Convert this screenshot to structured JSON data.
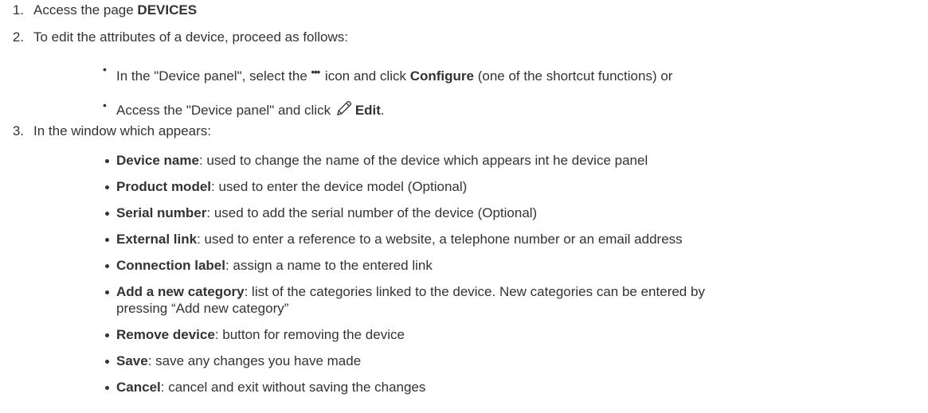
{
  "steps": [
    {
      "num": "1.",
      "prefix": "Access the page ",
      "bold": "DEVICES",
      "suffix": ""
    },
    {
      "num": "2.",
      "text": "To edit the attributes of a device, proceed as follows:"
    },
    {
      "num": "3.",
      "text": "In the window which appears:"
    }
  ],
  "step2_bullets": [
    {
      "bullet": "•",
      "before": "In the \"Device panel\", select the ",
      "icon": "more-dots-icon",
      "icon_glyph": "•••",
      "middle": " icon and click ",
      "bold": "Configure",
      "after": " (one of the shortcut functions) or"
    },
    {
      "bullet": "•",
      "before": "Access the \"Device panel\" and click ",
      "icon": "edit-pencil-icon",
      "bold": "Edit",
      "after": "."
    }
  ],
  "step3_bullets": [
    {
      "term": "Device name",
      "desc": ": used to change the name of the device which appears int he device panel"
    },
    {
      "term": "Product model",
      "desc": ": used to enter the device model (Optional)"
    },
    {
      "term": "Serial number",
      "desc": ": used to add the serial number of the device (Optional)"
    },
    {
      "term": "External link",
      "desc": ": used to enter a reference to a website, a telephone number or an email address"
    },
    {
      "term": "Connection label",
      "desc": ": assign a name to the entered link"
    },
    {
      "term": "Add a new category",
      "desc": ": list of the categories linked to the device. New categories can be entered by",
      "desc2": "pressing “Add new category”"
    },
    {
      "term": "Remove device",
      "desc": ": button for removing the device"
    },
    {
      "term": "Save",
      "desc": ": save any changes you have made"
    },
    {
      "term": "Cancel",
      "desc": ": cancel and exit without saving the changes"
    }
  ],
  "colors": {
    "text": "#333333",
    "background": "#ffffff"
  }
}
